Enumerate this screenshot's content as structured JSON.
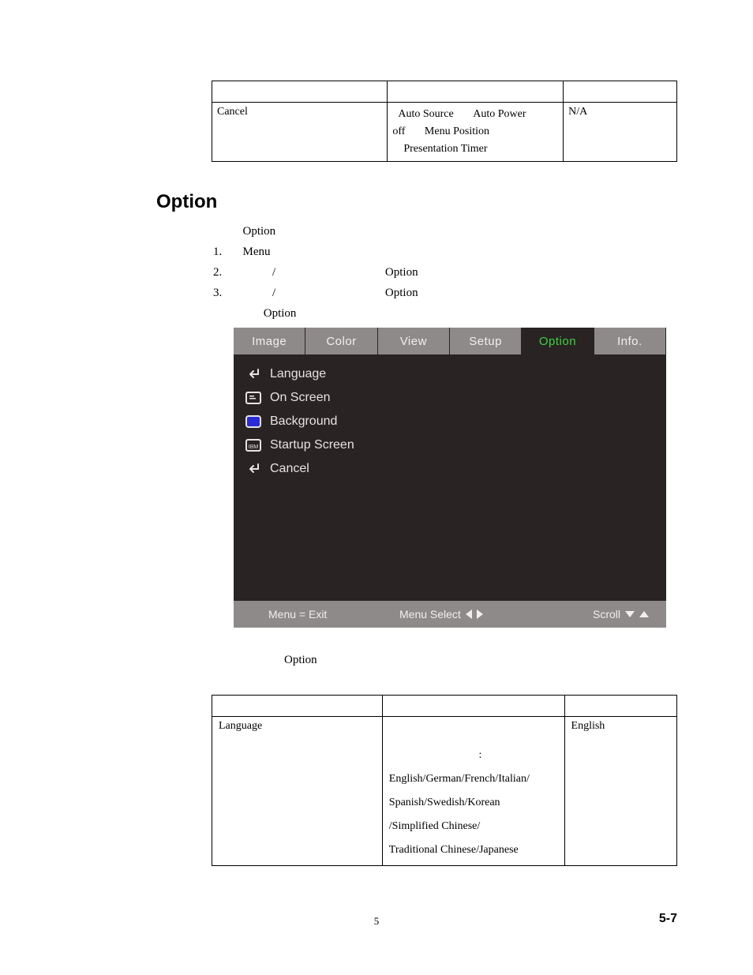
{
  "top_table": {
    "col1": "Cancel",
    "col2_line1a": "Auto Source",
    "col2_line1b": "Auto Power",
    "col2_line2a": "off",
    "col2_line2b": "Menu Position",
    "col2_line3": "Presentation Timer",
    "col3": "N/A"
  },
  "heading": "Option",
  "intro": {
    "l0": "Option",
    "l1_num": "1.",
    "l1_text": "Menu",
    "l2_num": "2.",
    "l2_mid": "/",
    "l2_right": "Option",
    "l3_num": "3.",
    "l3_mid": "/",
    "l3_right": "Option",
    "l4": "Option"
  },
  "osd": {
    "tabs": [
      "Image",
      "Color",
      "View",
      "Setup",
      "Option",
      "Info."
    ],
    "active_tab": "Option",
    "items": [
      {
        "icon": "enter",
        "label": "Language"
      },
      {
        "icon": "screen",
        "label": "On Screen"
      },
      {
        "icon": "bg",
        "label": "Background"
      },
      {
        "icon": "startup",
        "label": "Startup Screen"
      },
      {
        "icon": "enter",
        "label": "Cancel"
      }
    ],
    "footer": {
      "left": "Menu = Exit",
      "mid": "Menu Select",
      "right": "Scroll"
    }
  },
  "under_osd": "Option",
  "bottom_table": {
    "col1": "Language",
    "col2_l1": ":",
    "col2_l2": "English/German/French/Italian/",
    "col2_l3": "Spanish/Swedish/Korean",
    "col2_l4": "/Simplified Chinese/",
    "col2_l5": "Traditional Chinese/Japanese",
    "col3": "English"
  },
  "page_center": "5",
  "page_right": "5-7"
}
